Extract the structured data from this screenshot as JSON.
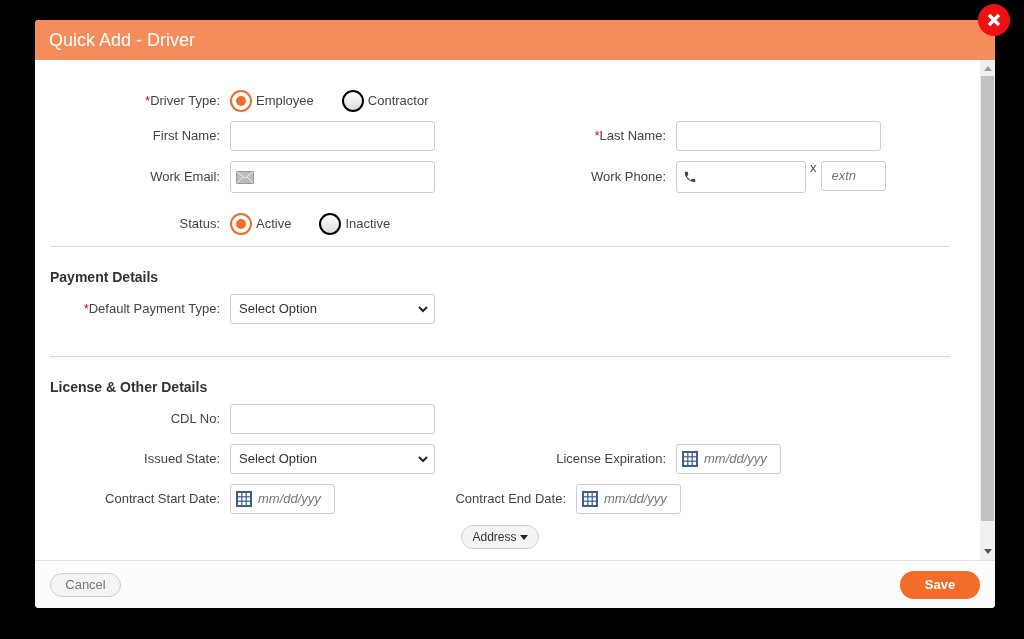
{
  "dialog": {
    "title": "Quick Add - Driver"
  },
  "driver_type": {
    "label": "Driver Type:",
    "required_mark": "*",
    "options": [
      {
        "label": "Employee",
        "selected": true
      },
      {
        "label": "Contractor",
        "selected": false
      }
    ]
  },
  "rows": [
    [
      {
        "kind": "text",
        "label": "First Name:"
      },
      {
        "kind": "text",
        "label": "Last Name:",
        "required_mark": "*"
      }
    ],
    [
      {
        "kind": "email",
        "label": "Work Email:"
      },
      {
        "kind": "phone",
        "label": "Work Phone:",
        "separator": "x",
        "ext_placeholder": "extn"
      }
    ]
  ],
  "status": {
    "label": "Status:",
    "options": [
      {
        "label": "Active",
        "selected": true
      },
      {
        "label": "Inactive",
        "selected": false
      }
    ]
  },
  "sections": [
    {
      "title": "Payment Details",
      "rows": [
        [
          {
            "kind": "select",
            "label": "Default Payment Type:",
            "required_mark": "*",
            "value": "Select Option"
          }
        ]
      ]
    },
    {
      "title": "License & Other Details",
      "rows": [
        [
          {
            "kind": "text",
            "label": "CDL No:"
          }
        ],
        [
          {
            "kind": "select",
            "label": "Issued State:",
            "value": "Select Option"
          },
          {
            "kind": "date",
            "label": "License Expiration:",
            "placeholder": "mm/dd/yyy"
          }
        ],
        [
          {
            "kind": "date",
            "label": "Contract Start Date:",
            "placeholder": "mm/dd/yyy"
          },
          {
            "kind": "date",
            "label": "Contract End Date:",
            "placeholder": "mm/dd/yyy"
          }
        ]
      ]
    }
  ],
  "address_button": "Address",
  "footer": {
    "cancel": "Cancel",
    "save": "Save"
  }
}
